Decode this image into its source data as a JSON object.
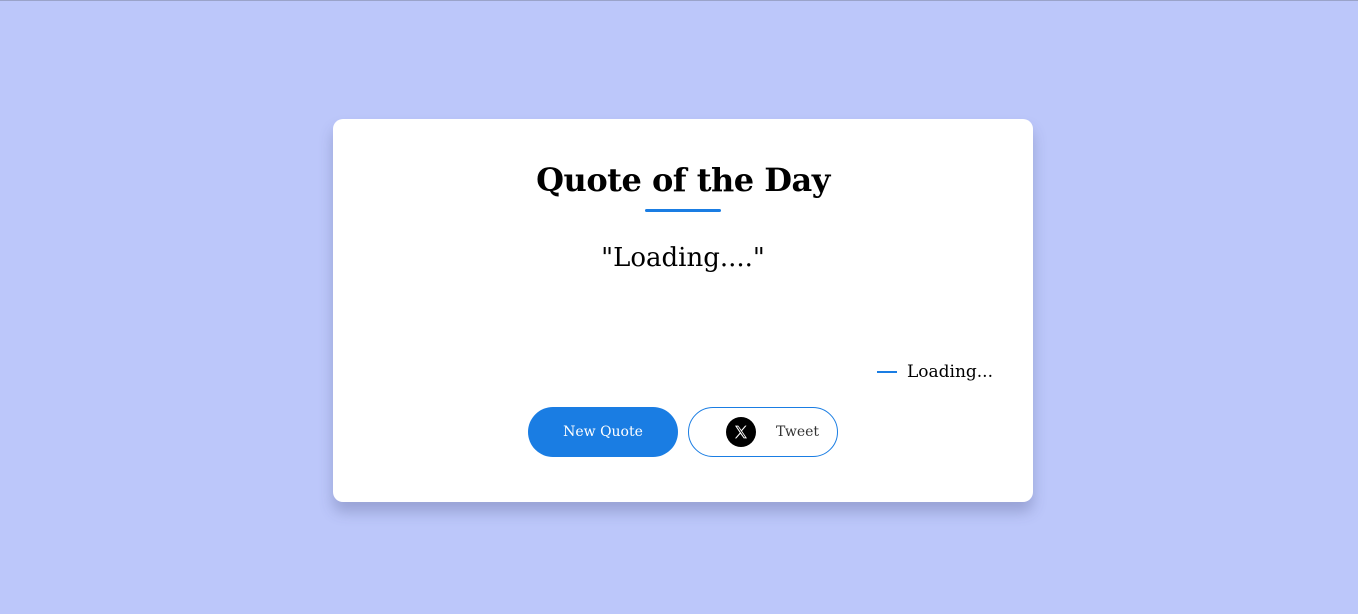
{
  "card": {
    "title": "Quote of the Day",
    "quote": "\"Loading....\"",
    "author": "Loading..."
  },
  "buttons": {
    "new_quote_label": "New Quote",
    "tweet_label": "Tweet",
    "tweet_icon": "x-logo-icon"
  },
  "colors": {
    "background": "#bcc7fa",
    "accent": "#1a7de3",
    "card": "#ffffff"
  }
}
